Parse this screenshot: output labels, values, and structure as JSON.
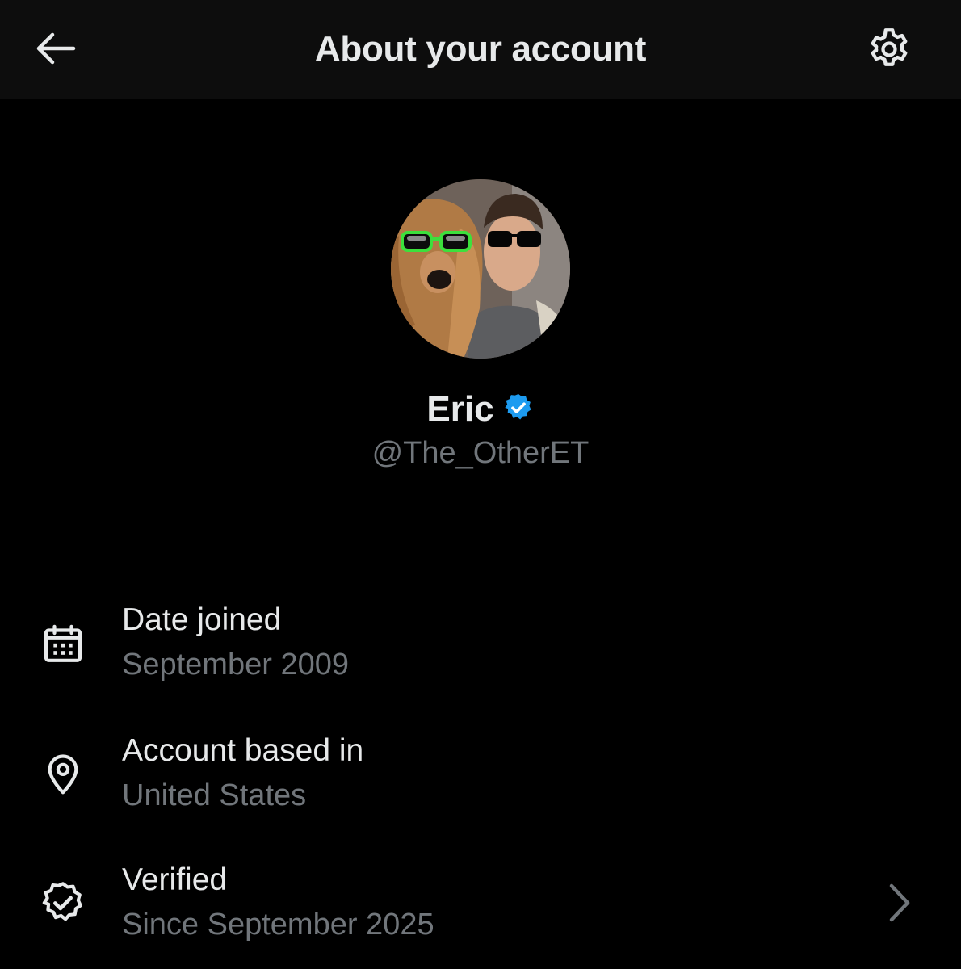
{
  "header": {
    "title": "About your account",
    "back_icon": "arrow-left-icon",
    "settings_icon": "gear-icon"
  },
  "profile": {
    "name": "Eric",
    "handle": "@The_OtherET",
    "verified_badge_icon": "verified-badge-icon",
    "badge_color": "#1d9bf0",
    "avatar_icon": "profile-photo"
  },
  "details": [
    {
      "icon": "calendar-icon",
      "label": "Date joined",
      "value": "September 2009"
    },
    {
      "icon": "location-pin-icon",
      "label": "Account based in",
      "value": "United States"
    },
    {
      "icon": "verified-check-icon",
      "label": "Verified",
      "value": "Since September 2025",
      "chevron_icon": "chevron-right-icon"
    }
  ],
  "colors": {
    "background": "#000000",
    "header_background": "#0d0d0d",
    "primary_text": "#e7e9ea",
    "secondary_text": "#71767b"
  }
}
